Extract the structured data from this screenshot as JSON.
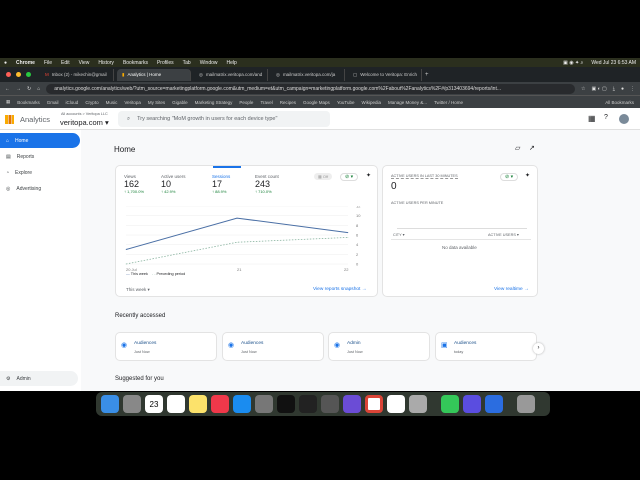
{
  "menubar": {
    "items": [
      "Chrome",
      "File",
      "Edit",
      "View",
      "History",
      "Bookmarks",
      "Profiles",
      "Tab",
      "Window",
      "Help"
    ],
    "clock": "Wed Jul 23 6:53 AM"
  },
  "tabs": [
    {
      "label": "Inbox (2) - mikechin@gmail"
    },
    {
      "label": "Analytics | Home"
    },
    {
      "label": "mailmatrix.veritopa.com/and"
    },
    {
      "label": "mailmatrix.veritopa.com/ja"
    },
    {
      "label": "Welcome to Veritopa: Enrich"
    }
  ],
  "address": {
    "url": "analytics.google.com/analytics/web/?utm_source=marketingplatform.google.com&utm_medium=et&utm_campaign=marketingplatform.google.com%2Fabout%2Fanalytics%2F#/p313403694/reports/int..."
  },
  "bookmarks": [
    "Bookmarks",
    "Gmail",
    "iCloud",
    "Crypto",
    "Music",
    "Veritopa",
    "My Sites",
    "Gigable",
    "Marketing Strategy",
    "People",
    "Travel",
    "Recipes",
    "Google Maps",
    "YouTube",
    "Wikipedia",
    "Manage Money &...",
    "Twitter / Home",
    "All Bookmarks"
  ],
  "ga": {
    "product": "Analytics",
    "breadcrumb": "All accounts > Veritopa LLC",
    "property": "veritopa.com",
    "search_placeholder": "Try searching \"MoM growth in users for each device type\""
  },
  "sidebar": {
    "items": [
      "Home",
      "Reports",
      "Explore",
      "Advertising"
    ],
    "admin": "Admin"
  },
  "page_title": "Home",
  "metrics": [
    {
      "label": "Views",
      "value": "162",
      "change": "↑ 1,700.0%"
    },
    {
      "label": "Active users",
      "value": "10",
      "change": "↑ 42.9%"
    },
    {
      "label": "Sessions",
      "value": "17",
      "change": "↑ 88.9%"
    },
    {
      "label": "Event count",
      "value": "243",
      "change": "↑ 710.0%"
    }
  ],
  "toggle_off": "Off",
  "chart_data": {
    "type": "line",
    "x": [
      "20 Jul",
      "21",
      "22"
    ],
    "ylim": [
      0,
      12
    ],
    "yticks": [
      "12",
      "10",
      "8",
      "6",
      "4",
      "2",
      "0"
    ],
    "series": [
      {
        "name": "This week",
        "values": [
          3,
          9.5,
          6.5
        ]
      },
      {
        "name": "Preceding period",
        "values": [
          0,
          4.5,
          5.5
        ]
      }
    ]
  },
  "date_range": "This week",
  "view_snapshot": "View reports snapshot →",
  "realtime": {
    "title": "ACTIVE USERS IN LAST 30 MINUTES",
    "value": "0",
    "per_minute": "ACTIVE USERS PER MINUTE",
    "col_city": "CITY ▾",
    "col_users": "ACTIVE USERS ▾",
    "empty": "No data available",
    "link": "View realtime →"
  },
  "recent": {
    "title": "Recently accessed",
    "items": [
      {
        "label": "Audiences",
        "time": "Just Now"
      },
      {
        "label": "Audiences",
        "time": "Just Now"
      },
      {
        "label": "Admin",
        "time": "Just Now"
      },
      {
        "label": "Audiences",
        "time": "today"
      }
    ]
  },
  "suggested": "Suggested for you",
  "colors": {
    "accent": "#1a73e8",
    "this_week": "#4a6fa5",
    "preceding": "#8ab4a0"
  }
}
